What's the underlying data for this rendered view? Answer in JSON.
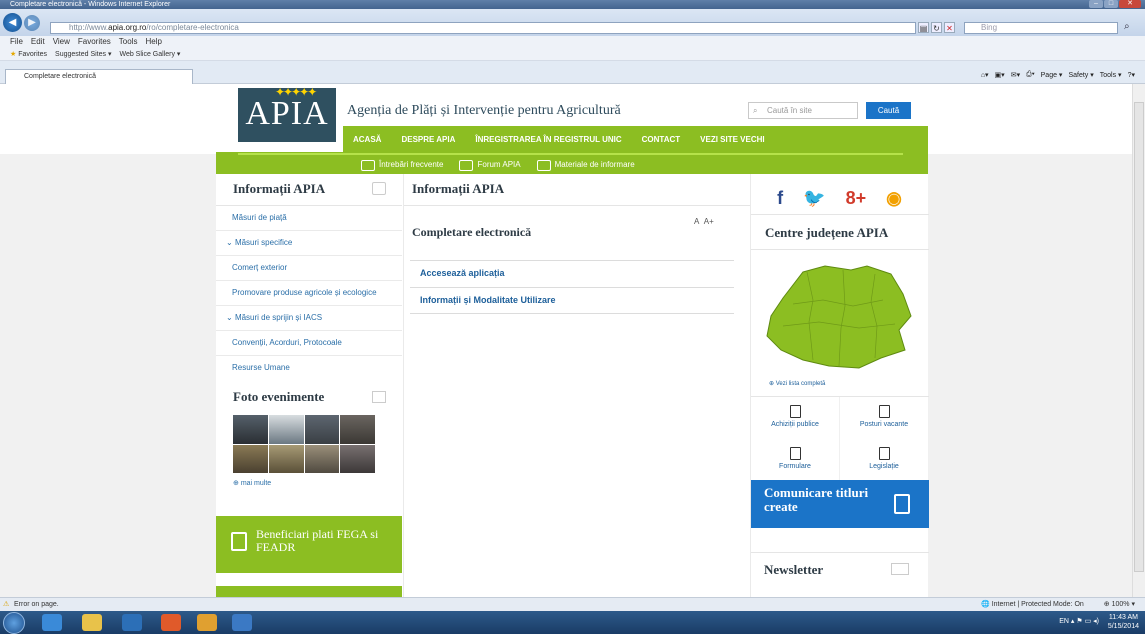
{
  "browser": {
    "title": "Completare electronică - Windows Internet Explorer",
    "url_prefix": "http://www.",
    "url_domain": "apia.org.ro",
    "url_path": "/ro/completare-electronica",
    "search_placeholder": "Bing",
    "menu": [
      "File",
      "Edit",
      "View",
      "Favorites",
      "Tools",
      "Help"
    ],
    "favorites_label": "Favorites",
    "favorites_items": [
      "Suggested Sites ▾",
      "Web Slice Gallery ▾"
    ],
    "tab_title": "Completare electronică",
    "command_items": [
      "Page ▾",
      "Safety ▾",
      "Tools ▾"
    ],
    "status_left": "Error on page.",
    "status_zone": "Internet | Protected Mode: On",
    "zoom": "100%"
  },
  "site": {
    "logo_text": "APIA",
    "agency_name": "Agenția de Plăți și Intervenție pentru Agricultură",
    "search_placeholder": "Caută în site",
    "search_button": "Caută",
    "nav": [
      "ACASĂ",
      "DESPRE APIA",
      "ÎNREGISTRAREA ÎN REGISTRUL UNIC",
      "CONTACT",
      "VEZI SITE VECHI"
    ],
    "subnav": [
      "Întrebări frecvente",
      "Forum APIA",
      "Materiale de informare"
    ]
  },
  "left": {
    "heading": "Informații APIA",
    "menu": [
      {
        "label": "Măsuri de piață",
        "expand": false
      },
      {
        "label": "Măsuri specifice",
        "expand": true
      },
      {
        "label": "Comerț exterior",
        "expand": false
      },
      {
        "label": "Promovare produse agricole și ecologice",
        "expand": false
      },
      {
        "label": "Măsuri de sprijin și IACS",
        "expand": true
      },
      {
        "label": "Convenții, Acorduri, Protocoale",
        "expand": false
      },
      {
        "label": "Resurse Umane",
        "expand": false
      }
    ],
    "foto_heading": "Foto evenimente",
    "more": "mai multe",
    "beneficiari": "Beneficiari plati FEGA si FEADR"
  },
  "main": {
    "heading": "Informații APIA",
    "font_small": "A",
    "font_large": "A+",
    "subheading": "Completare electronică",
    "links": [
      "Accesează aplicația",
      "Informații și Modalitate Utilizare"
    ]
  },
  "right": {
    "social": [
      "f",
      "t",
      "g+",
      "rss"
    ],
    "centre_heading": "Centre județene APIA",
    "vezi": "Vezi lista completă",
    "quick": [
      "Achiziții publice",
      "Posturi vacante",
      "Formulare",
      "Legislație"
    ],
    "comunicare": "Comunicare titluri create",
    "newsletter": "Newsletter"
  },
  "taskbar": {
    "lang": "EN",
    "time": "11:43 AM",
    "date": "5/15/2014"
  },
  "colors": {
    "green": "#8cbe22",
    "blue": "#1b74c8",
    "logo_bg": "#2f5060"
  }
}
